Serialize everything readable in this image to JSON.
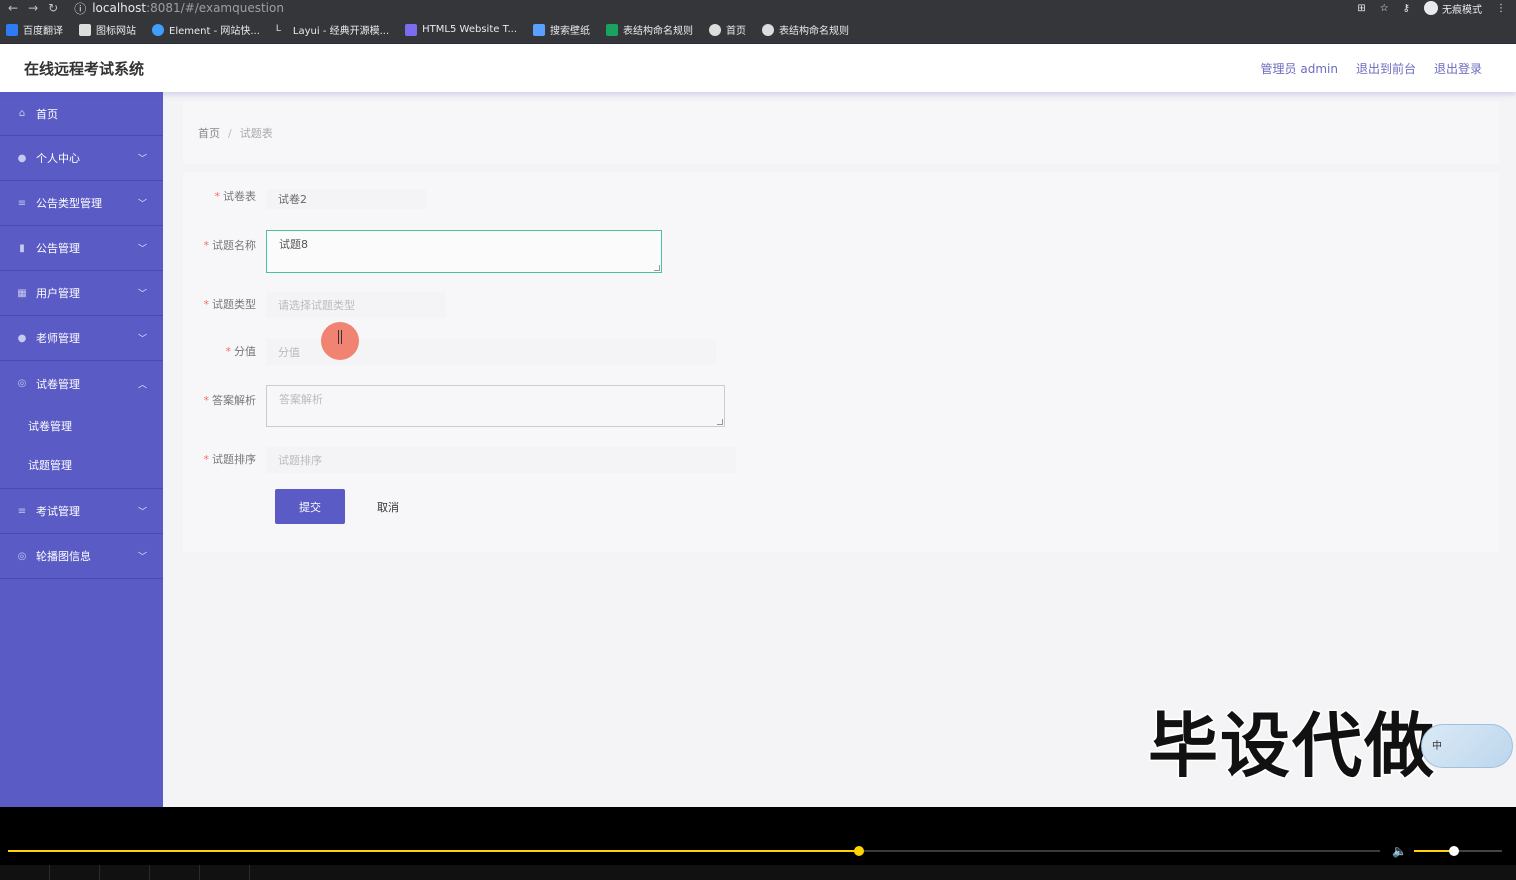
{
  "browser": {
    "url_host": "localhost",
    "url_path": ":8081/#/examquestion",
    "profile_label": "无痕模式",
    "bookmarks": [
      "百度翻译",
      "图标网站",
      "Element - 网站快...",
      "Layui - 经典开源模...",
      "HTML5 Website T...",
      "搜索壁纸",
      "表结构命名规则",
      "首页",
      "表结构命名规则"
    ]
  },
  "header": {
    "title": "在线远程考试系统",
    "user": "管理员 admin",
    "to_front": "退出到前台",
    "logout": "退出登录"
  },
  "sidebar": {
    "home": "首页",
    "personal": "个人中心",
    "notice_type": "公告类型管理",
    "notice": "公告管理",
    "user": "用户管理",
    "teacher": "老师管理",
    "paper_mgmt": "试卷管理",
    "sub_paper": "试卷管理",
    "sub_question": "试题管理",
    "exam": "考试管理",
    "carousel": "轮播图信息"
  },
  "breadcrumb": {
    "home": "首页",
    "current": "试题表"
  },
  "form": {
    "paper_label": "试卷表",
    "paper_value": "试卷2",
    "name_label": "试题名称",
    "name_value": "试题8",
    "type_label": "试题类型",
    "type_placeholder": "请选择试题类型",
    "score_label": "分值",
    "score_placeholder": "分值",
    "analysis_label": "答案解析",
    "analysis_placeholder": "答案解析",
    "order_label": "试题排序",
    "order_placeholder": "试题排序",
    "submit": "提交",
    "cancel": "取消"
  },
  "overlay": {
    "watermark": "毕设代做",
    "ime_label": "中"
  },
  "player": {
    "progress": 0.62,
    "volume": 0.45
  },
  "colors": {
    "accent": "#5b5bc6",
    "active_border": "#4ac29a",
    "required": "#f56c6c",
    "player_bar": "#ffd400"
  }
}
